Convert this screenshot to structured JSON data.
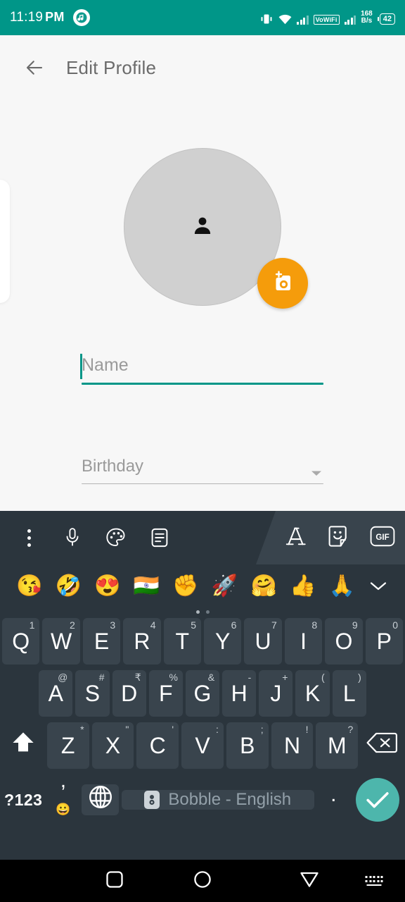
{
  "statusbar": {
    "time": "11:19",
    "ampm": "PM",
    "app_icon": "notification-app-icon",
    "vowifi_label": "VoWiFi",
    "network_speed_value": "168",
    "network_speed_unit": "B/s",
    "battery_level": "42",
    "icons": [
      "vibrate-icon",
      "wifi-icon",
      "signal-bars-icon",
      "vowifi-badge",
      "signal-bars-2-icon",
      "network-speed",
      "battery-icon"
    ],
    "background_color": "#009688"
  },
  "appbar": {
    "back_icon": "back-arrow-icon",
    "title": "Edit Profile"
  },
  "profile": {
    "avatar_placeholder_icon": "person-icon",
    "avatar_color": "#d0d0d0",
    "camera_button_icon": "add-photo-camera-icon",
    "camera_button_color": "#f59c0b"
  },
  "form": {
    "name": {
      "placeholder": "Name",
      "value": "",
      "focused": true,
      "underline_color": "#009688"
    },
    "birthday": {
      "placeholder": "Birthday",
      "value": "",
      "focused": false,
      "underline_color": "#b4b4b4",
      "dropdown_icon": "chevron-down-icon"
    }
  },
  "keyboard": {
    "background_color": "#2b353d",
    "key_color": "#39444d",
    "toolbar_left": [
      {
        "name": "overflow-menu-icon",
        "label": "more-options"
      },
      {
        "name": "microphone-icon",
        "label": "voice-input"
      },
      {
        "name": "palette-icon",
        "label": "themes"
      },
      {
        "name": "clipboard-icon",
        "label": "clipboard"
      }
    ],
    "toolbar_right": [
      {
        "name": "font-style-icon",
        "label": "A"
      },
      {
        "name": "sticker-icon",
        "label": "stickers"
      },
      {
        "name": "gif-icon",
        "label": "GIF"
      }
    ],
    "emoji_row": [
      "😘",
      "🤣",
      "😍",
      "🇮🇳",
      "✊",
      "🚀",
      "🤗",
      "👍",
      "🙏"
    ],
    "emoji_collapse_icon": "chevron-down-icon",
    "page_dots": 2,
    "page_dot_active": 0,
    "row1": [
      {
        "key": "Q",
        "hint": "1"
      },
      {
        "key": "W",
        "hint": "2"
      },
      {
        "key": "E",
        "hint": "3"
      },
      {
        "key": "R",
        "hint": "4"
      },
      {
        "key": "T",
        "hint": "5"
      },
      {
        "key": "Y",
        "hint": "6"
      },
      {
        "key": "U",
        "hint": "7"
      },
      {
        "key": "I",
        "hint": "8"
      },
      {
        "key": "O",
        "hint": "9"
      },
      {
        "key": "P",
        "hint": "0"
      }
    ],
    "row2": [
      {
        "key": "A",
        "hint": "@"
      },
      {
        "key": "S",
        "hint": "#"
      },
      {
        "key": "D",
        "hint": "₹"
      },
      {
        "key": "F",
        "hint": "%"
      },
      {
        "key": "G",
        "hint": "&"
      },
      {
        "key": "H",
        "hint": "-"
      },
      {
        "key": "J",
        "hint": "+"
      },
      {
        "key": "K",
        "hint": "("
      },
      {
        "key": "L",
        "hint": ")"
      }
    ],
    "row3": [
      {
        "key": "Z",
        "hint": "*"
      },
      {
        "key": "X",
        "hint": "\""
      },
      {
        "key": "C",
        "hint": "'"
      },
      {
        "key": "V",
        "hint": ":"
      },
      {
        "key": "B",
        "hint": ";"
      },
      {
        "key": "N",
        "hint": "!"
      },
      {
        "key": "M",
        "hint": "?"
      }
    ],
    "shift_icon": "shift-up-arrow-icon",
    "backspace_icon": "backspace-delete-icon",
    "row4": {
      "symbols_label": "?123",
      "comma_label": ",",
      "comma_hint": "😀",
      "globe_icon": "globe-language-icon",
      "space_label": "Bobble - English",
      "space_logo": "bobble-logo-icon",
      "period_label": ".",
      "enter_icon": "check-enter-icon",
      "enter_color": "#4db6ac"
    }
  },
  "navbar": {
    "background_color": "#000000",
    "items": [
      {
        "name": "nav-recents-button",
        "icon": "square-recents-icon"
      },
      {
        "name": "nav-home-button",
        "icon": "circle-home-icon"
      },
      {
        "name": "nav-back-button",
        "icon": "triangle-back-icon"
      },
      {
        "name": "nav-hide-keyboard-button",
        "icon": "keyboard-dismiss-icon"
      }
    ]
  }
}
